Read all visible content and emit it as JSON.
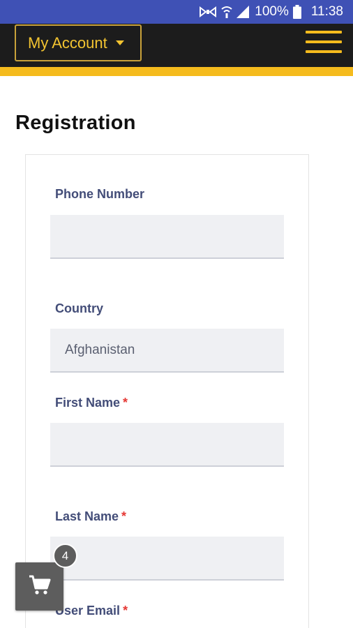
{
  "status_bar": {
    "battery": "100%",
    "time": "11:38",
    "icons": [
      "nfc-icon",
      "wifi-icon",
      "signal-icon",
      "battery-icon"
    ]
  },
  "header": {
    "account_label": "My Account",
    "menu_icon": "hamburger-icon",
    "accent_color": "#f5bb1d",
    "background_color": "#1c1c1c"
  },
  "page": {
    "title": "Registration"
  },
  "form": {
    "phone_label": "Phone Number",
    "phone_value": "",
    "country_label": "Country",
    "country_value": "Afghanistan",
    "first_name_label": "First Name",
    "first_name_value": "",
    "last_name_label": "Last Name",
    "last_name_value": "",
    "email_label": "User Email",
    "required_mark": "*"
  },
  "cart": {
    "icon": "cart-icon",
    "count": "4"
  }
}
